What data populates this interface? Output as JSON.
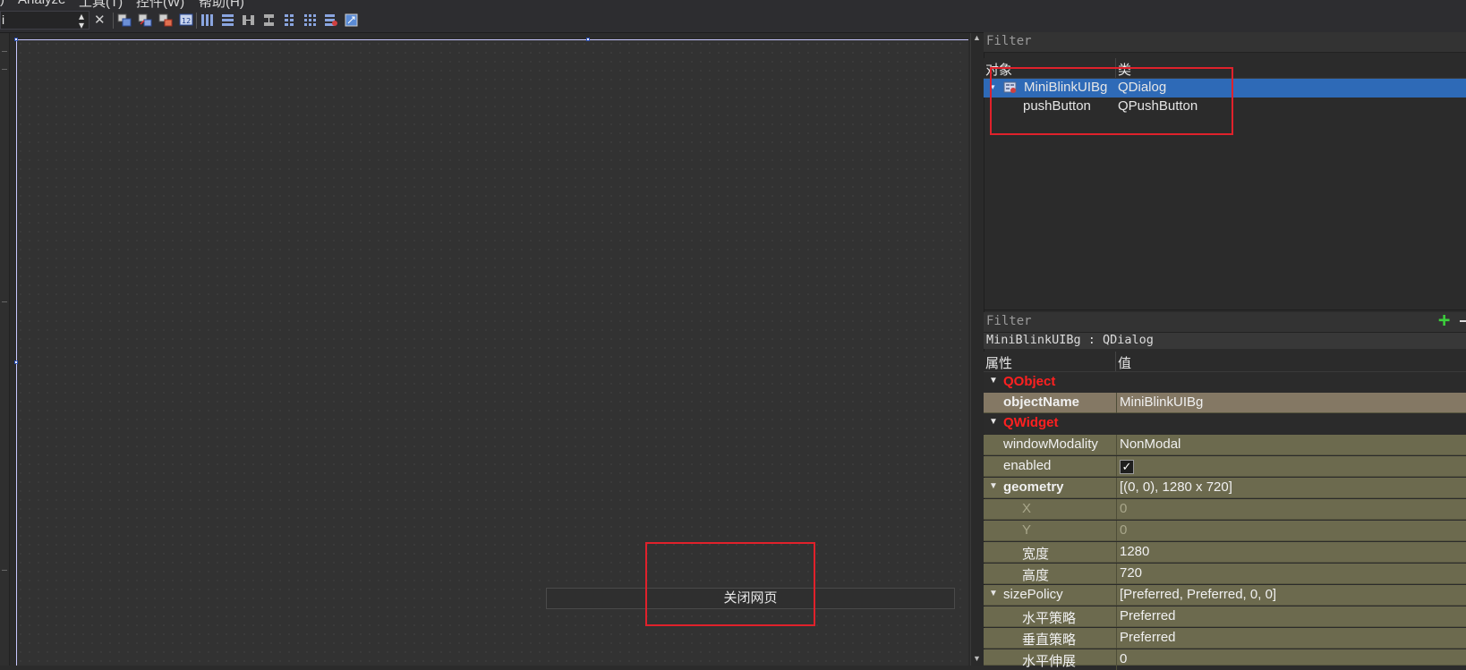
{
  "menubar": {
    "items": [
      {
        "label": ")"
      },
      {
        "label": "Analyze"
      },
      {
        "label": "工具(T)"
      },
      {
        "label": "控件(W)"
      },
      {
        "label": "帮助(H)"
      }
    ]
  },
  "toolbar": {
    "combo_value": "i",
    "buttons": [
      "edit-widgets-icon",
      "edit-signals-icon",
      "edit-buddies-icon",
      "edit-tab-order-icon",
      "layout-horizontal-icon",
      "layout-vertical-icon",
      "layout-h-splitter-icon",
      "layout-v-splitter-icon",
      "layout-form-icon",
      "layout-grid-icon",
      "break-layout-icon",
      "adjust-size-icon"
    ]
  },
  "form": {
    "push_button_label": "关闭网页"
  },
  "object_inspector": {
    "filter_placeholder": "Filter",
    "columns": [
      "对象",
      "类"
    ],
    "rows": [
      {
        "name": "MiniBlinkUIBg",
        "class": "QDialog",
        "selected": true
      },
      {
        "name": "pushButton",
        "class": "QPushButton",
        "selected": false
      }
    ]
  },
  "property_editor": {
    "filter_placeholder": "Filter",
    "add_label": "+",
    "selected_object": "MiniBlinkUIBg : QDialog",
    "columns": [
      "属性",
      "值"
    ],
    "groups": {
      "qobject": "QObject",
      "qwidget": "QWidget"
    },
    "props": {
      "objectName": {
        "name": "objectName",
        "value": "MiniBlinkUIBg"
      },
      "windowModality": {
        "name": "windowModality",
        "value": "NonModal"
      },
      "enabled": {
        "name": "enabled",
        "value": "✓"
      },
      "geometry": {
        "name": "geometry",
        "value": "[(0, 0), 1280 x 720]"
      },
      "x": {
        "name": "X",
        "value": "0"
      },
      "y": {
        "name": "Y",
        "value": "0"
      },
      "width": {
        "name": "宽度",
        "value": "1280"
      },
      "height": {
        "name": "高度",
        "value": "720"
      },
      "sizePolicy": {
        "name": "sizePolicy",
        "value": "[Preferred, Preferred, 0, 0]"
      },
      "hpolicy": {
        "name": "水平策略",
        "value": "Preferred"
      },
      "vpolicy": {
        "name": "垂直策略",
        "value": "Preferred"
      },
      "hstretch": {
        "name": "水平伸展",
        "value": "0"
      }
    }
  },
  "colors": {
    "highlight_box": "#e0212b",
    "selection": "#2e6ab7",
    "property_row": "#6c6a4e",
    "group_label": "#ff2020",
    "add_icon": "#3ccf3c"
  }
}
